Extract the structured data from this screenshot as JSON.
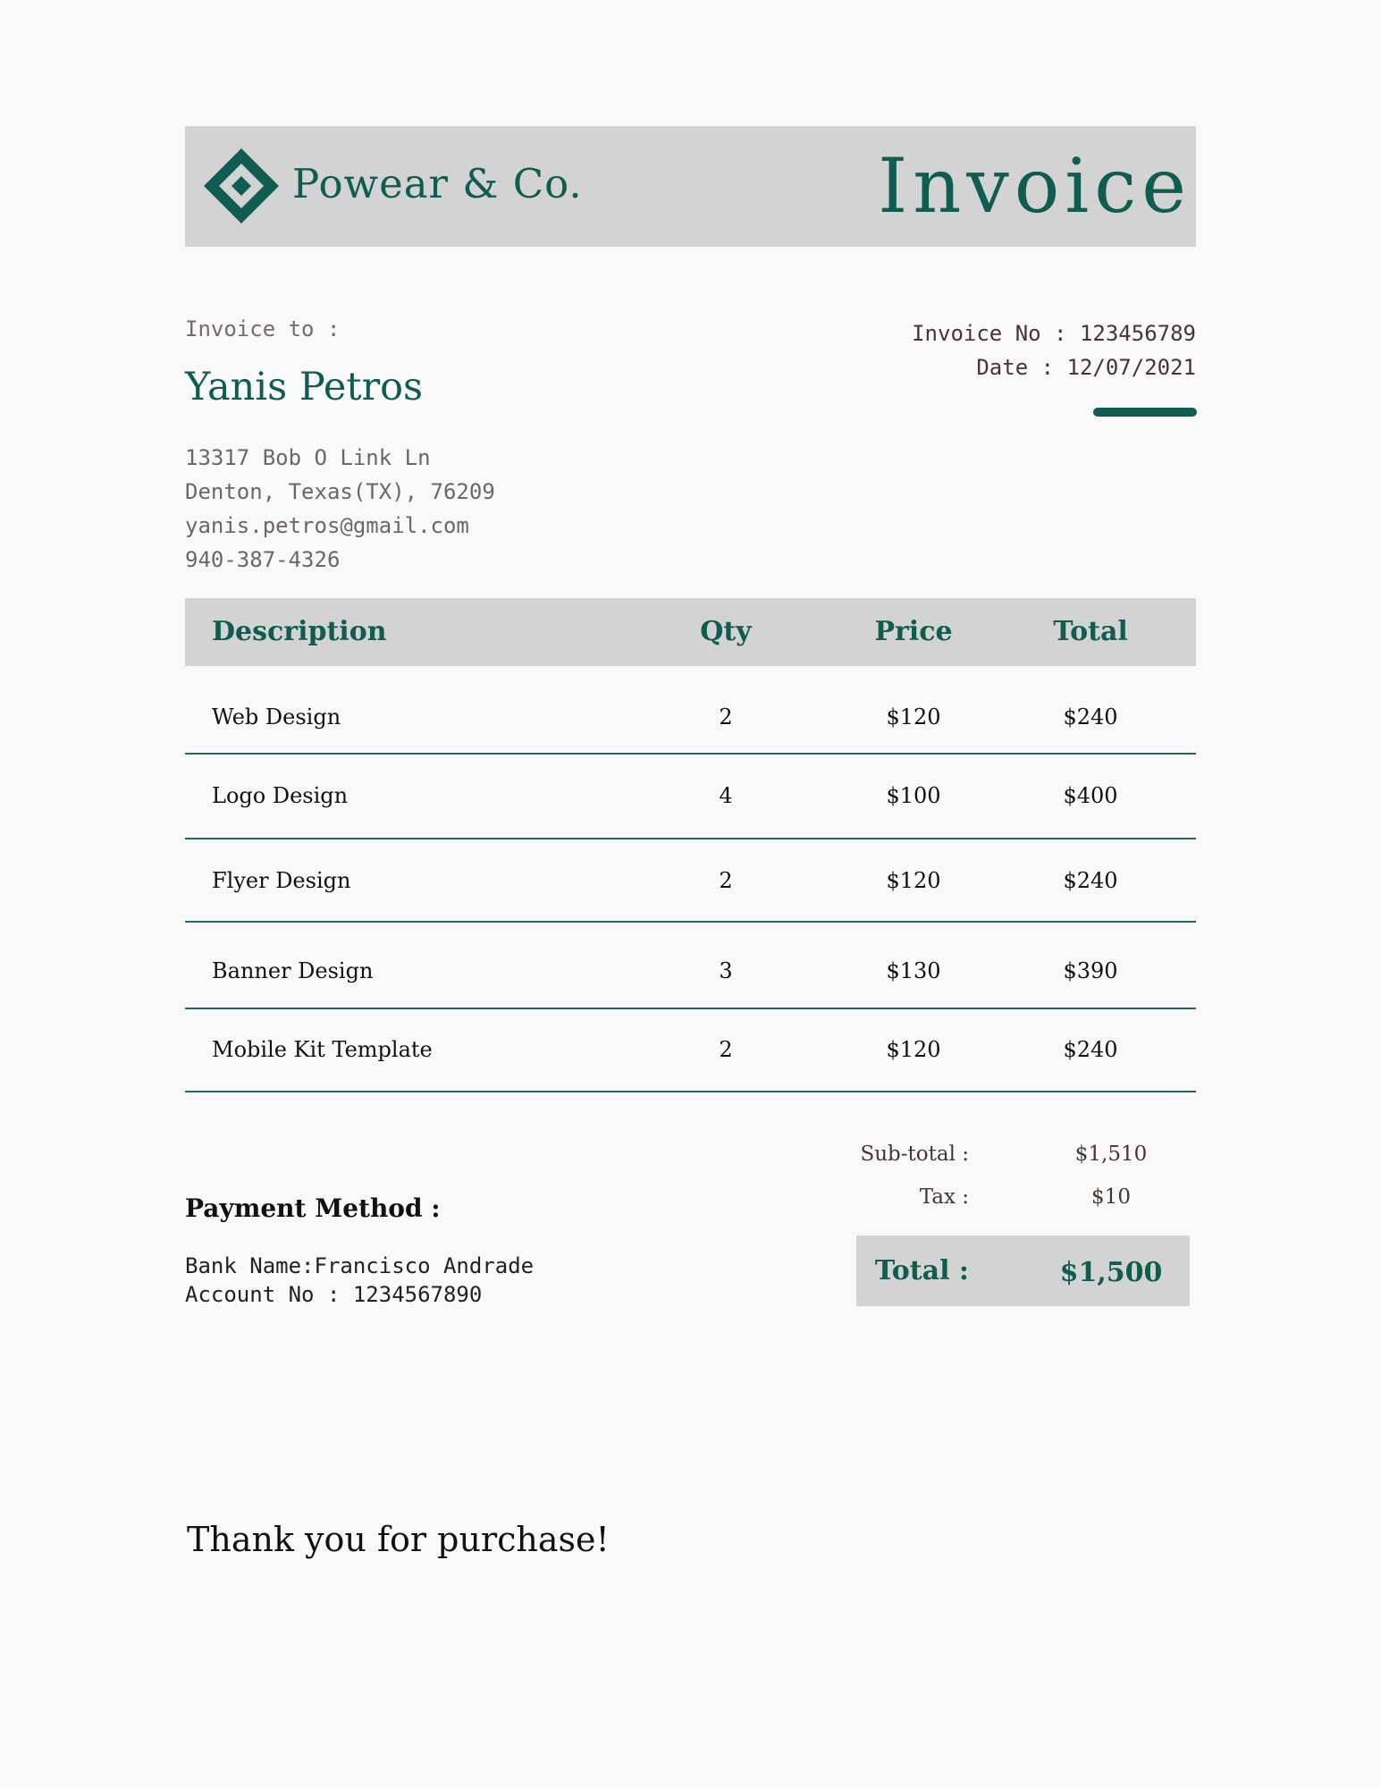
{
  "brand": {
    "company_name": "Powear & Co.",
    "logo_icon": "diamond-logo-icon",
    "accent_color": "#0f5c50",
    "band_color": "#d3d3d3"
  },
  "document": {
    "title": "Invoice"
  },
  "bill_to": {
    "label": "Invoice to :",
    "name": "Yanis Petros",
    "address_lines": [
      "13317 Bob O Link Ln",
      "Denton, Texas(TX), 76209",
      "yanis.petros@gmail.com",
      "940-387-4326"
    ]
  },
  "meta": {
    "invoice_no": "Invoice No : 123456789",
    "date": "Date : 12/07/2021"
  },
  "table": {
    "headers": {
      "description": "Description",
      "qty": "Qty",
      "price": "Price",
      "total": "Total"
    },
    "rows": [
      {
        "description": "Web Design",
        "qty": "2",
        "price": "$120",
        "total": "$240"
      },
      {
        "description": "Logo Design",
        "qty": "4",
        "price": "$100",
        "total": "$400"
      },
      {
        "description": "Flyer Design",
        "qty": "2",
        "price": "$120",
        "total": "$240"
      },
      {
        "description": "Banner Design",
        "qty": "3",
        "price": "$130",
        "total": "$390"
      },
      {
        "description": "Mobile Kit Template",
        "qty": "2",
        "price": "$120",
        "total": "$240"
      }
    ]
  },
  "summary": {
    "subtotal_label": "Sub-total :",
    "subtotal_value": "$1,510",
    "tax_label": "Tax :",
    "tax_value": "$10",
    "total_label": "Total :",
    "total_value": "$1,500"
  },
  "payment": {
    "title": "Payment Method :",
    "lines": [
      "Bank Name:Francisco Andrade",
      "Account No : 1234567890"
    ]
  },
  "footer": {
    "thank_you": "Thank you for purchase!"
  }
}
